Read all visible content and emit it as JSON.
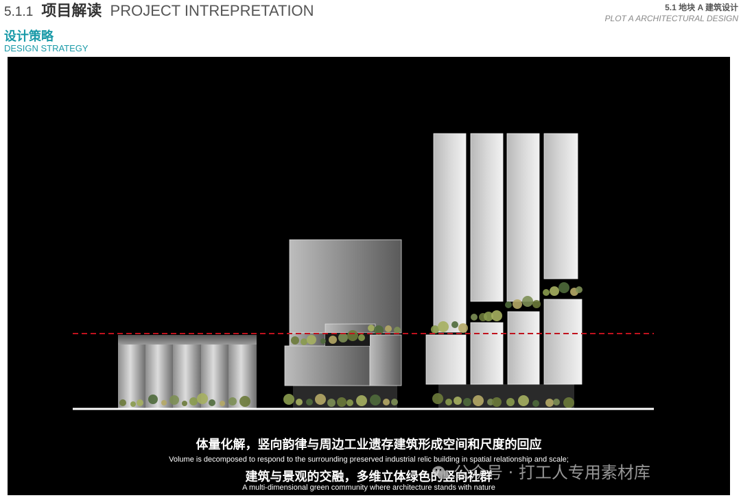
{
  "header": {
    "section_number": "5.1.1",
    "section_title_zh": "项目解读",
    "section_title_en": "PROJECT INTREPRETATION",
    "subtitle_zh": "设计策略",
    "subtitle_en": "DESIGN STRATEGY",
    "right_line1": "5.1 地块 A 建筑设计",
    "right_line2": "PLOT A ARCHITECTURAL DESIGN"
  },
  "diagram": {
    "colors": {
      "background": "#000000",
      "ground_line": "#ffffff",
      "datum_line": "#c0121d",
      "podium": "#2a2a2a",
      "greenery": [
        "#6b7a3a",
        "#8a9b4e",
        "#a6b060",
        "#4f6a3b",
        "#b5a866",
        "#7d8f55"
      ]
    }
  },
  "captions": {
    "line1_zh": "体量化解，竖向韵律与周边工业遗存建筑形成空间和尺度的回应",
    "line1_en": "Volume is decomposed to respond to the surrounding preserved industrial relic building in spatial relationship and scale;",
    "line2_zh": "建筑与景观的交融，多维立体绿色的竖向社群",
    "line2_en": "A multi-dimensional green community where architecture stands with nature"
  },
  "watermark": {
    "text": "公众号 · 打工人专用素材库",
    "icon": "wechat-icon"
  }
}
